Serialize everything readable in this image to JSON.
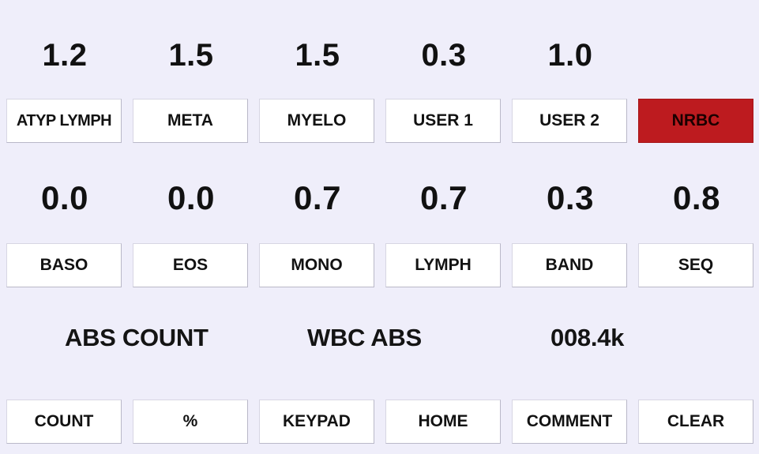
{
  "row1": {
    "values": [
      "1.2",
      "1.5",
      "1.5",
      "0.3",
      "1.0"
    ],
    "buttons": [
      "ATYP LYMPH",
      "META",
      "MYELO",
      "USER 1",
      "USER 2",
      "NRBC"
    ]
  },
  "row2": {
    "values": [
      "0.0",
      "0.0",
      "0.7",
      "0.7",
      "0.3",
      "0.8"
    ],
    "buttons": [
      "BASO",
      "EOS",
      "MONO",
      "LYMPH",
      "BAND",
      "SEQ"
    ]
  },
  "abs": {
    "label": "ABS COUNT",
    "wbc_label": "WBC ABS",
    "wbc_value": "008.4k"
  },
  "bottom_buttons": [
    "COUNT",
    "%",
    "KEYPAD",
    "HOME",
    "COMMENT",
    "CLEAR"
  ],
  "colors": {
    "background": "#efeefa",
    "active_button": "#bd1b1f",
    "button": "#ffffff"
  },
  "active_button": "NRBC"
}
